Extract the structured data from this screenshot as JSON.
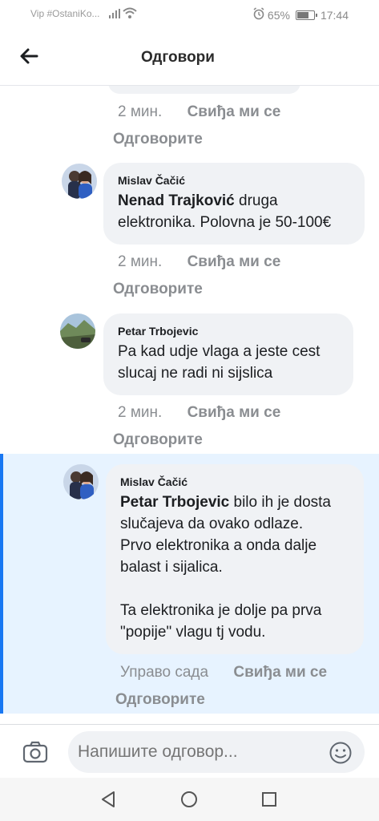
{
  "status_bar": {
    "carrier": "Vip #OstaniKo...",
    "battery_percent": "65%",
    "time": "17:44"
  },
  "header": {
    "title": "Одговори"
  },
  "comments": [
    {
      "time": "2 мин.",
      "like_label": "Свиђа ми се",
      "reply_label": "Одговорите"
    },
    {
      "author": "Mislav Čačić",
      "mention": "Nenad Trajković",
      "text_lines": [
        "druga",
        "elektronika. Polovna je 50-100€"
      ],
      "time": "2 мин.",
      "like_label": "Свиђа ми се",
      "reply_label": "Одговорите"
    },
    {
      "author": "Petar Trbojevic",
      "text_lines": [
        "Pa kad udje vlaga a jeste cest",
        "slucaj ne radi ni sijslica"
      ],
      "time": "2 мин.",
      "like_label": "Свиђа ми се",
      "reply_label": "Одговорите"
    },
    {
      "author": "Mislav Čačić",
      "mention": "Petar Trbojevic",
      "text_lines": [
        "bilo ih je dosta",
        "slučajeva da ovako odlaze.",
        "Prvo elektronika a onda dalje",
        "balast i sijalica.",
        "",
        "Ta elektronika je dolje pa prva",
        "\"popije\" vlagu tj vodu."
      ],
      "time": "Управо сада",
      "like_label": "Свиђа ми се",
      "reply_label": "Одговорите"
    }
  ],
  "composer": {
    "placeholder": "Напишите одговор..."
  },
  "colors": {
    "accent": "#1877f2",
    "highlight_bg": "#e7f3ff",
    "bubble_bg": "#f0f2f5",
    "meta_text": "#8a8d91"
  }
}
